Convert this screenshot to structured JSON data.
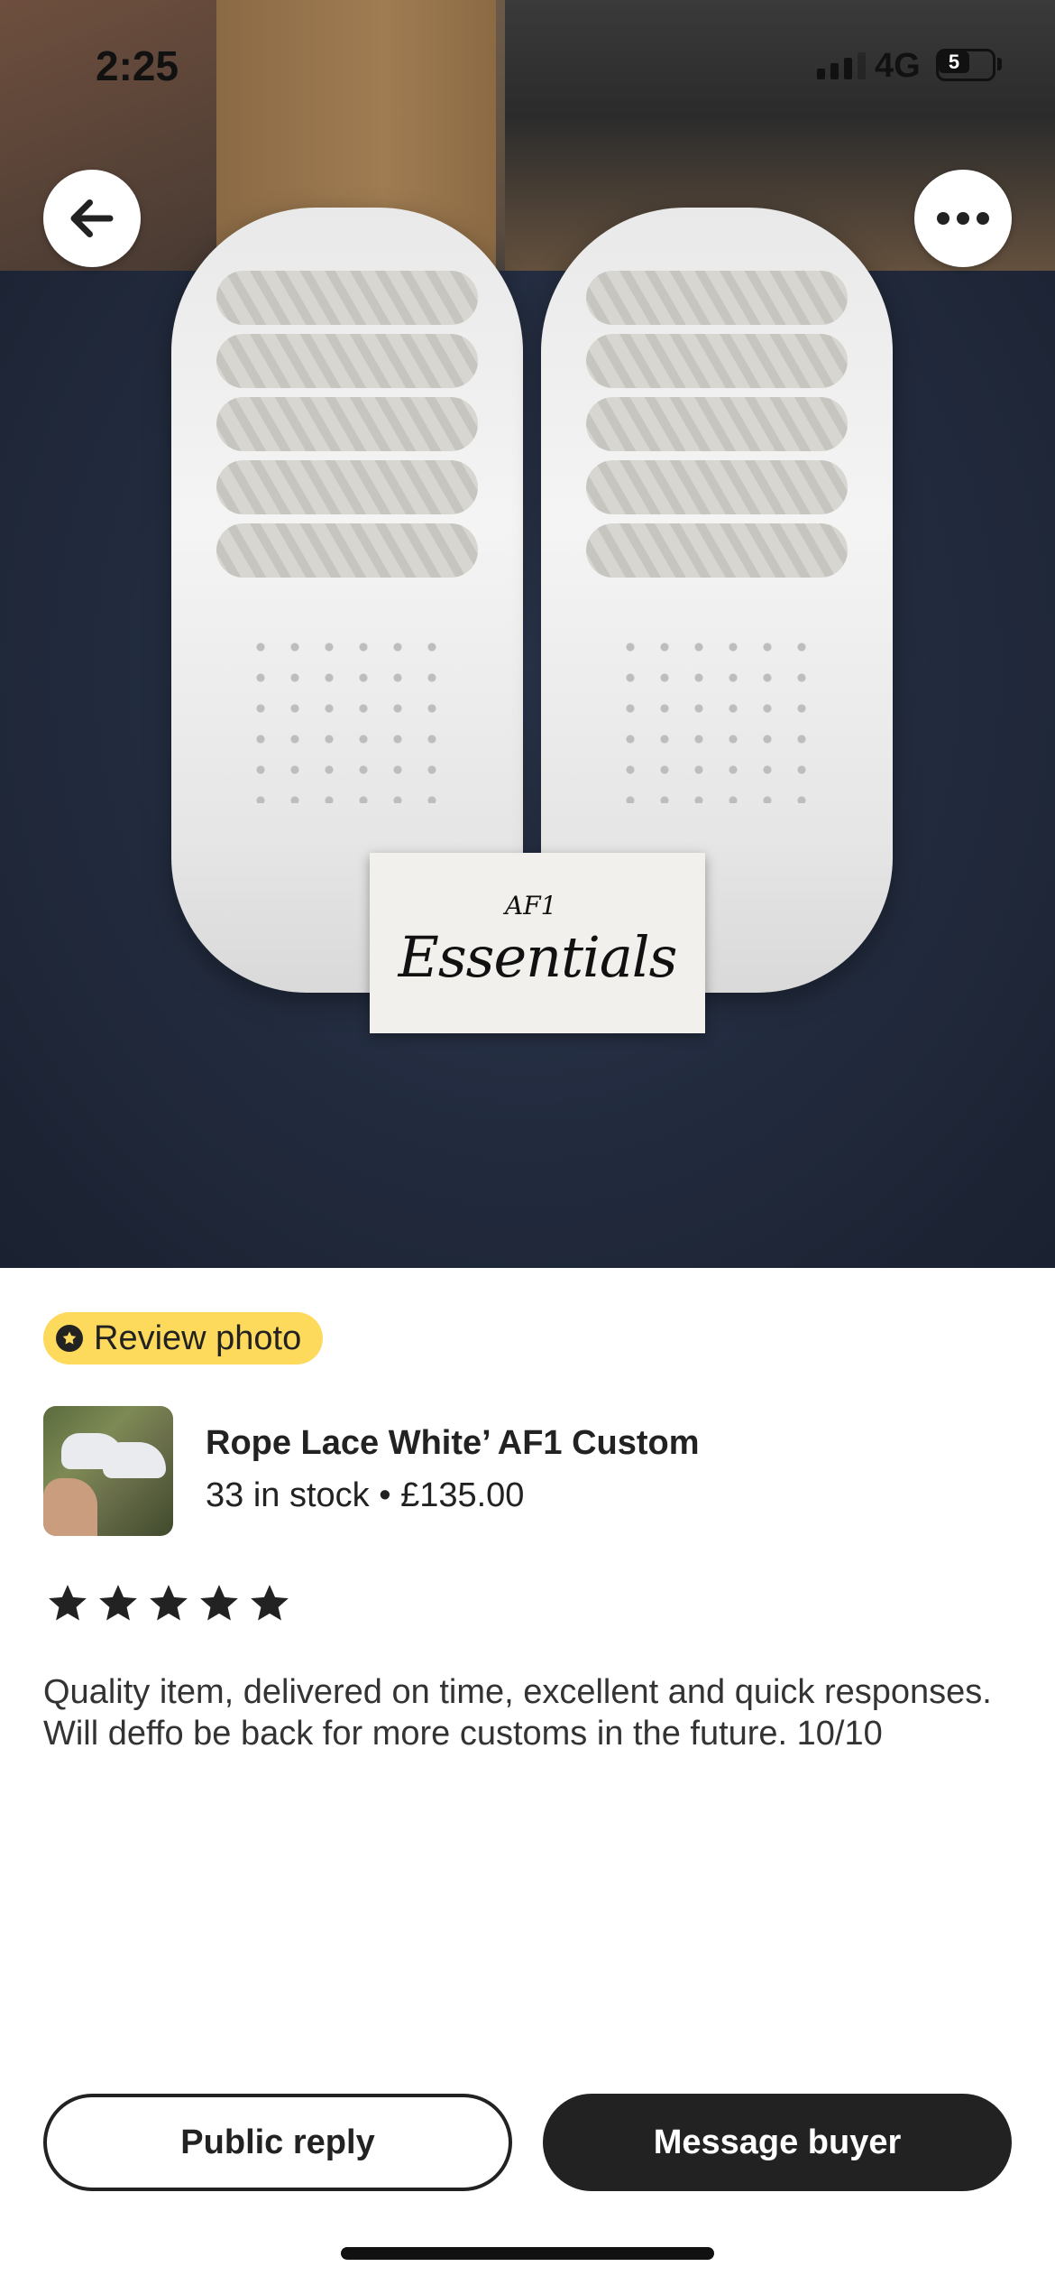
{
  "status_bar": {
    "time": "2:25",
    "network": "4G",
    "battery": "5"
  },
  "photo": {
    "card_text_small": "AF1",
    "card_text": "Essentials"
  },
  "nav": {
    "back_icon": "arrow-left-icon",
    "more_icon": "more-horizontal-icon"
  },
  "badge": {
    "label": "Review photo",
    "icon": "star-circle-icon",
    "color": "#fdd95c"
  },
  "item": {
    "title": "Rope Lace White’ AF1 Custom",
    "stock_price": "33 in stock • £135.00"
  },
  "rating": {
    "stars": 5,
    "max": 5
  },
  "review": {
    "text": "Quality item, delivered on time, excellent and quick responses. Will deffo be back for more customs in the future. 10/10"
  },
  "actions": {
    "public_reply": "Public reply",
    "message_buyer": "Message buyer"
  },
  "colors": {
    "primary_dark": "#222222",
    "badge_yellow": "#fdd95c"
  }
}
